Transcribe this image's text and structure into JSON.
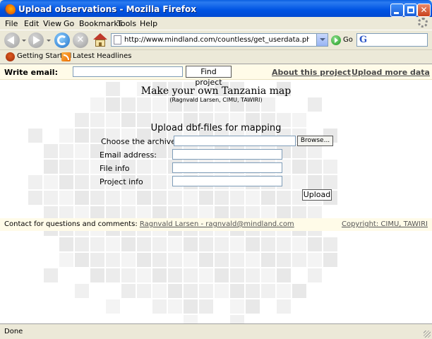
{
  "window": {
    "title": "Upload observations - Mozilla Firefox"
  },
  "menu": {
    "file": "File",
    "edit": "Edit",
    "view": "View",
    "go": "Go",
    "bookmarks": "Bookmarks",
    "tools": "Tools",
    "help": "Help"
  },
  "toolbar": {
    "url": "http://www.mindland.com/countless/get_userdata.php",
    "go_label": "Go",
    "search_value": ""
  },
  "bookmarks": {
    "getting_started": "Getting Started",
    "latest_headlines": "Latest Headlines"
  },
  "header": {
    "write_email_label": "Write email:",
    "email_value": "",
    "find_project_label": "Find project",
    "about_link": "About this project",
    "upload_more_link": "Upload more data"
  },
  "main": {
    "title": "Make your own Tanzania map",
    "subtitle": "(Ragnvald Larsen, CIMU, TAWIRI)",
    "upload_heading": "Upload dbf-files for mapping",
    "choose_archive_label": "Choose the archive:",
    "browse_label": "Browse...",
    "email_label": "Email address:",
    "file_info_label": "File info",
    "project_info_label": "Project info",
    "upload_label": "Upload"
  },
  "footer": {
    "contact_text": "Contact for questions and comments:",
    "contact_link": "Ragnvald Larsen - ragnvald@mindland.com",
    "copyright_link": "Copyright: CIMU, TAWIRI"
  },
  "status": {
    "text": "Done"
  }
}
